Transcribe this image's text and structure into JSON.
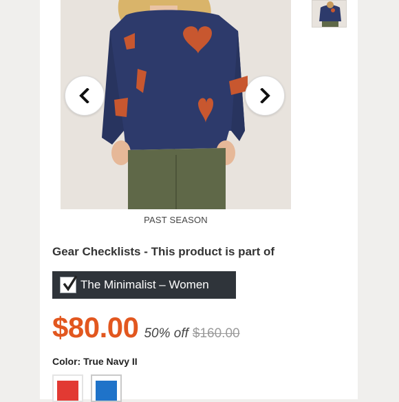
{
  "product": {
    "season_caption": "PAST SEASON",
    "checklist_heading": "Gear Checklists - This product is part of",
    "checklist_name": "The Minimalist – Women",
    "price": "$80.00",
    "discount": "50% off",
    "original_price": "$160.00",
    "color_label": "Color: True Navy II"
  },
  "swatches": [
    {
      "name": "red",
      "color": "#e23a33"
    },
    {
      "name": "blue",
      "color": "#1f73c9"
    }
  ],
  "colors": {
    "accent_price": "#e2571f",
    "badge_bg": "#2f343a",
    "sweater": "#2d3a6b",
    "heart": "#c8572f",
    "pants": "#5f6848"
  },
  "icons": {
    "prev": "chevron-left-icon",
    "next": "chevron-right-icon",
    "check": "checkmark-icon"
  }
}
